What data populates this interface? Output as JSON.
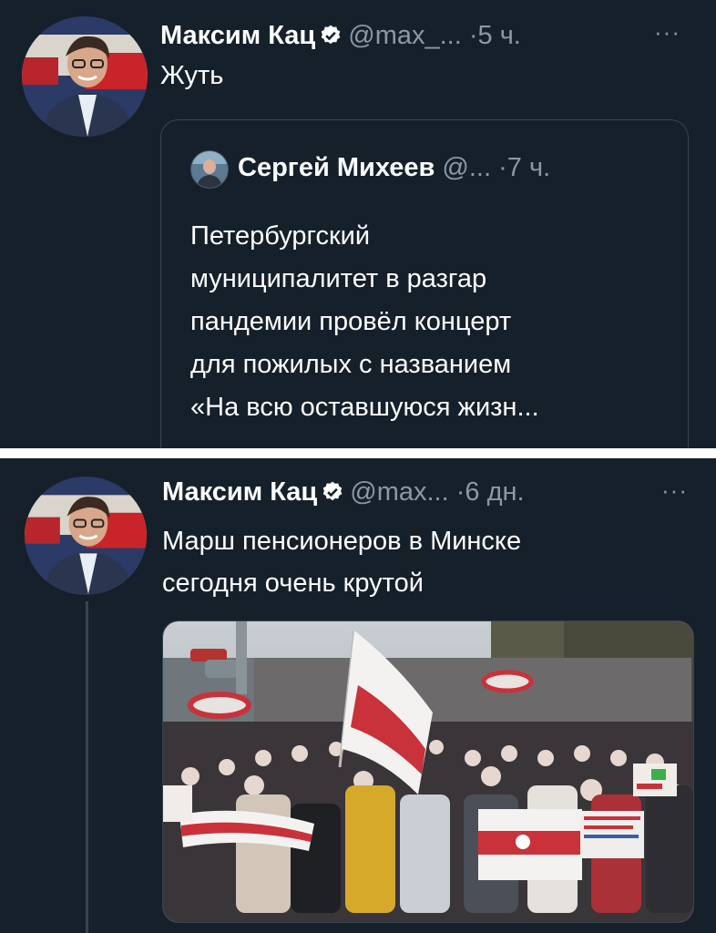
{
  "top_tweet": {
    "author_name": "Максим Кац",
    "handle": "@max_...",
    "separator": "·",
    "time": "5 ч.",
    "more": "···",
    "text": "Жуть",
    "quote": {
      "author_name": "Сергей Михеев",
      "handle": "@...",
      "separator": "·",
      "time": "7 ч.",
      "lines": [
        "Петербургский",
        "муниципалитет в разгар",
        "пандемии провёл концерт",
        "для пожилых с названием",
        "«На всю оставшуюся жизн..."
      ]
    }
  },
  "bottom_tweet": {
    "author_name": "Максим Кац",
    "handle": "@max...",
    "separator": "·",
    "time": "6 дн.",
    "more": "···",
    "lines": [
      "Марш пенсионеров в Минске",
      "сегодня очень крутой"
    ]
  },
  "icons": {
    "verified": "verified-badge-icon",
    "more": "more-options-icon"
  },
  "colors": {
    "background": "#15202b",
    "text": "#ffffff",
    "secondary_text": "#8b98a5",
    "border": "#38444d",
    "separator": "#ffffff"
  }
}
